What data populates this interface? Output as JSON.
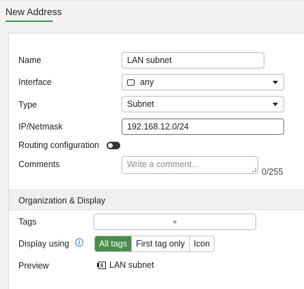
{
  "header": {
    "title": "New Address"
  },
  "form": {
    "name": {
      "label": "Name",
      "value": "LAN subnet"
    },
    "interface": {
      "label": "Interface",
      "value": "any",
      "icon": "interface-port-icon"
    },
    "type": {
      "label": "Type",
      "value": "Subnet"
    },
    "ip_netmask": {
      "label": "IP/Netmask",
      "value": "192.168.12.0/24"
    },
    "routing": {
      "label": "Routing configuration",
      "enabled": false
    },
    "comments": {
      "label": "Comments",
      "placeholder": "Write a comment...",
      "counter": "0/255"
    }
  },
  "org_display": {
    "title": "Organization & Display",
    "tags": {
      "label": "Tags",
      "add_symbol": "+"
    },
    "display_using": {
      "label": "Display using",
      "info_icon": "i",
      "options": [
        "All tags",
        "First tag only",
        "Icon"
      ],
      "selected": "All tags"
    },
    "preview": {
      "label": "Preview",
      "value": "LAN subnet",
      "icon": "address-object-icon"
    }
  },
  "colors": {
    "accent": "#4a8c4a",
    "info": "#3b7fc4"
  }
}
